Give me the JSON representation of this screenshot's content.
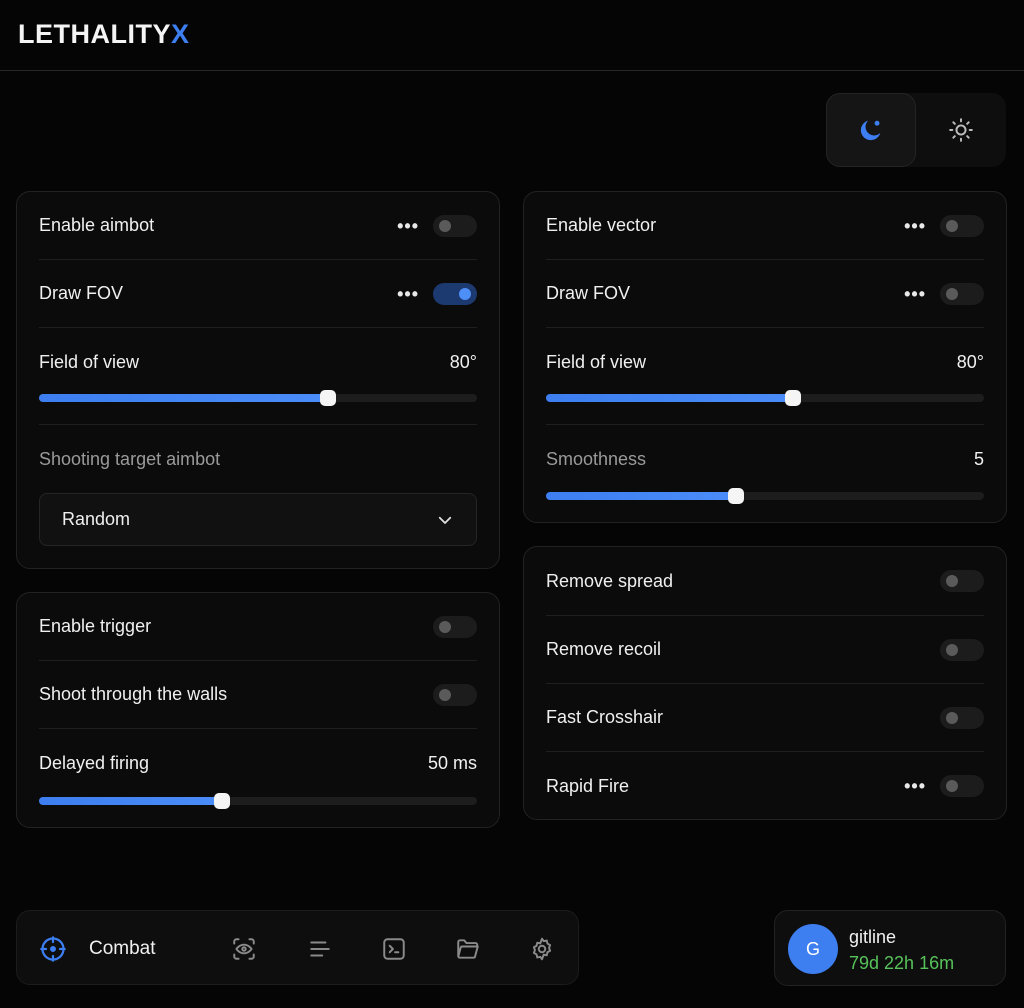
{
  "app": {
    "logo_text": "LETHALITY",
    "logo_accent": "X",
    "accent_color": "#3d7ef0"
  },
  "theme_toggle": {
    "dark_icon": "moon-icon",
    "light_icon": "sun-icon",
    "active": "dark"
  },
  "aimbot": {
    "enable": {
      "label": "Enable aimbot",
      "on": false
    },
    "draw_fov": {
      "label": "Draw FOV",
      "on": true
    },
    "fov": {
      "label": "Field of view",
      "value": "80°",
      "fraction": 0.66
    },
    "target": {
      "label": "Shooting target aimbot",
      "selected": "Random"
    }
  },
  "vector": {
    "enable": {
      "label": "Enable vector",
      "on": false
    },
    "draw_fov": {
      "label": "Draw FOV",
      "on": false
    },
    "fov": {
      "label": "Field of view",
      "value": "80°",
      "fraction": 0.564
    },
    "smoothness": {
      "label": "Smoothness",
      "value": "5",
      "fraction": 0.433
    }
  },
  "trigger": {
    "enable": {
      "label": "Enable trigger",
      "on": false
    },
    "walls": {
      "label": "Shoot through the walls",
      "on": false
    },
    "delay": {
      "label": "Delayed firing",
      "value": "50 ms",
      "fraction": 0.417
    }
  },
  "misc": {
    "spread": {
      "label": "Remove spread",
      "on": false
    },
    "recoil": {
      "label": "Remove recoil",
      "on": false
    },
    "crosshair": {
      "label": "Fast Crosshair",
      "on": false
    },
    "rapid": {
      "label": "Rapid Fire",
      "on": false
    }
  },
  "nav": {
    "active_label": "Combat",
    "items": [
      "crosshair-icon",
      "eye-scan-icon",
      "align-lines-icon",
      "terminal-icon",
      "folder-icon",
      "gear-icon"
    ]
  },
  "user": {
    "initial": "G",
    "name": "gitline",
    "time_left": "79d 22h 16m",
    "time_color": "#57c25a"
  }
}
